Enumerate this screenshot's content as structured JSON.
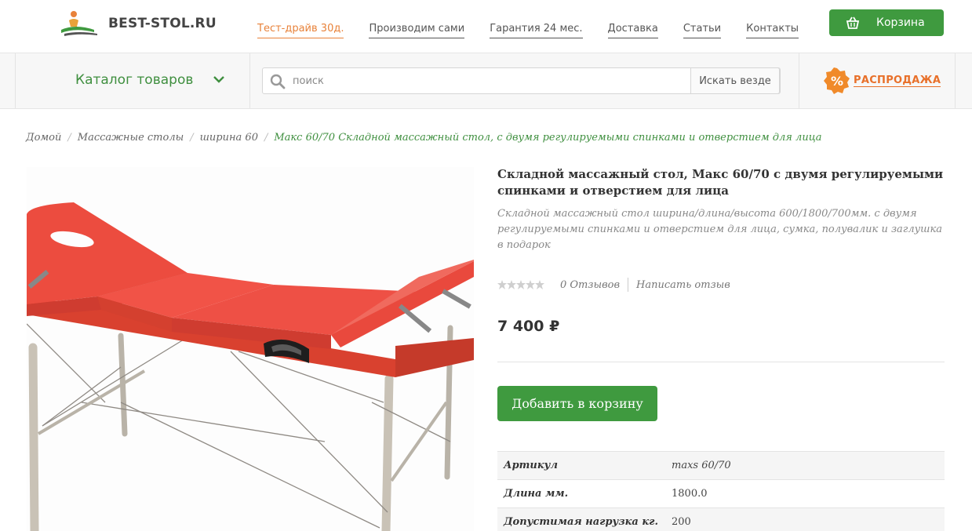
{
  "header": {
    "logo_text": "BEST-STOL.RU",
    "nav": [
      {
        "label": "Тест-драйв 30д.",
        "highlight": true
      },
      {
        "label": "Производим сами"
      },
      {
        "label": "Гарантия 24 мес."
      },
      {
        "label": "Доставка"
      },
      {
        "label": "Статьи"
      },
      {
        "label": "Контакты"
      }
    ],
    "cart_label": "Корзина"
  },
  "bar": {
    "catalog_label": "Каталог товаров",
    "search_placeholder": "поиск",
    "search_button": "Искать везде",
    "sale_label": "РАСПРОДАЖА",
    "sale_symbol": "%"
  },
  "breadcrumb": [
    {
      "label": "Домой"
    },
    {
      "label": "Массажные столы"
    },
    {
      "label": "ширина 60"
    },
    {
      "label": "Макс 60/70 Складной массажный стол, с двумя регулируемыми спинками и отверстием для лица",
      "current": true
    }
  ],
  "product": {
    "title": "Складной массажный стол, Макс 60/70 с двумя регулируемыми спинками и отверстием для лица",
    "description": "Складной массажный стол ширина/длина/высота 600/1800/700мм. с двумя регулируемыми спинками и отверстием для лица, сумка, полувалик и заглушка в подарок",
    "rating": 0,
    "reviews_label": "0 Отзывов",
    "write_review_label": "Написать отзыв",
    "price": "7 400 ₽",
    "add_to_cart_label": "Добавить в корзину",
    "specs": [
      {
        "key": "Артикул",
        "value": "maxs 60/70",
        "italic": true
      },
      {
        "key": "Длина мм.",
        "value": "1800.0"
      },
      {
        "key": "Допустимая нагрузка кг.",
        "value": "200"
      }
    ]
  },
  "colors": {
    "brand_green": "#3f9a3f",
    "accent_orange": "#e8823a",
    "table_red": "#e4463c"
  }
}
